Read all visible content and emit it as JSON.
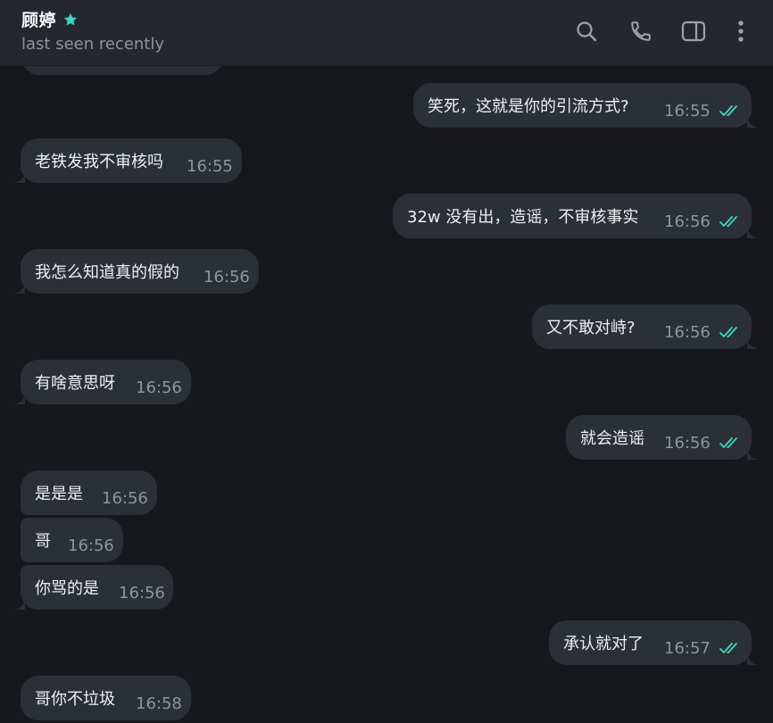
{
  "header": {
    "contact_name": "顾婷",
    "status": "last seen recently",
    "accent": "#3ed6c3",
    "icons": [
      "search-icon",
      "phone-icon",
      "sidebar-toggle-icon",
      "more-vertical-icon"
    ]
  },
  "messages": [
    {
      "side": "out",
      "text": "笑死，这就是你的引流方式?",
      "time": "16:55",
      "read": true
    },
    {
      "side": "in",
      "text": "老铁发我不审核吗",
      "time": "16:55"
    },
    {
      "side": "out",
      "text": "32w 没有出，造谣，不审核事实",
      "time": "16:56",
      "read": true
    },
    {
      "side": "in",
      "text": "我怎么知道真的假的",
      "time": "16:56"
    },
    {
      "side": "out",
      "text": "又不敢对峙?",
      "time": "16:56",
      "read": true
    },
    {
      "side": "in",
      "text": "有啥意思呀",
      "time": "16:56"
    },
    {
      "side": "out",
      "text": "就会造谣",
      "time": "16:56",
      "read": true
    },
    {
      "side": "in",
      "text": "是是是",
      "time": "16:56"
    },
    {
      "side": "in",
      "text": "哥",
      "time": "16:56"
    },
    {
      "side": "in",
      "text": "你骂的是",
      "time": "16:56"
    },
    {
      "side": "out",
      "text": "承认就对了",
      "time": "16:57",
      "read": true
    },
    {
      "side": "in",
      "text": "哥你不垃圾",
      "time": "16:58"
    }
  ]
}
